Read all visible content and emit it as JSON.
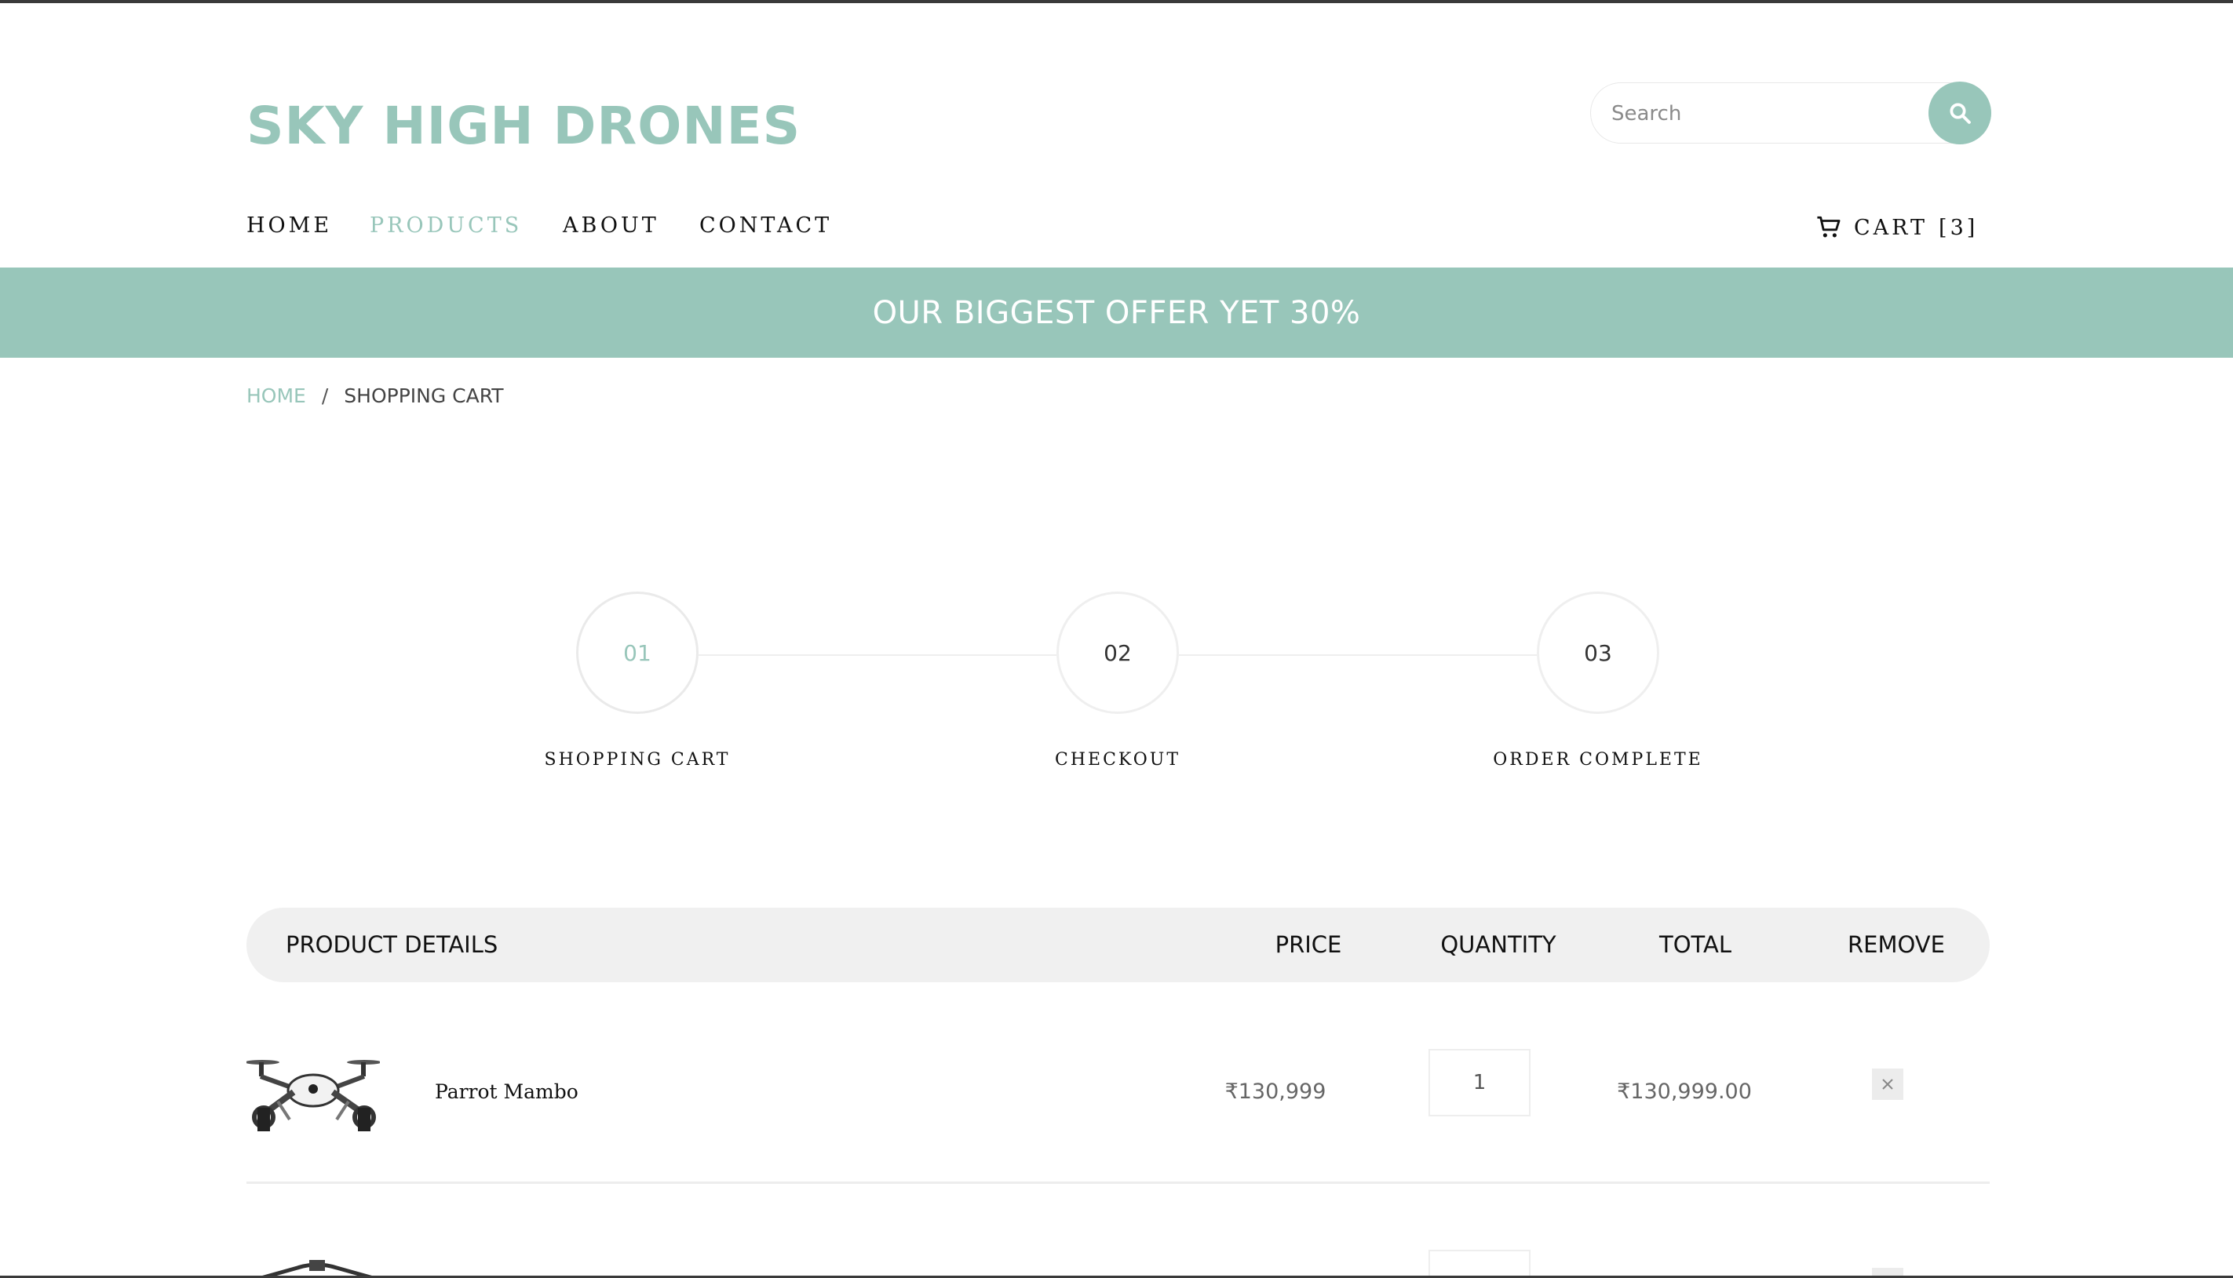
{
  "brand": {
    "name": "SKY HIGH DRONES",
    "accent": "#98c6ba"
  },
  "search": {
    "placeholder": "Search",
    "icon": "search-icon"
  },
  "nav": {
    "items": [
      "HOME",
      "PRODUCTS",
      "ABOUT",
      "CONTACT"
    ],
    "active": "PRODUCTS"
  },
  "cart": {
    "label": "CART",
    "count": "[3]",
    "icon": "cart-icon"
  },
  "banner": {
    "text": "OUR BIGGEST OFFER YET 30%"
  },
  "breadcrumb": {
    "home": "HOME",
    "separator": "/",
    "current": "SHOPPING CART"
  },
  "steps": [
    {
      "number": "01",
      "label": "SHOPPING CART",
      "active": true
    },
    {
      "number": "02",
      "label": "CHECKOUT",
      "active": false
    },
    {
      "number": "03",
      "label": "ORDER COMPLETE",
      "active": false
    }
  ],
  "table": {
    "headers": {
      "product": "PRODUCT DETAILS",
      "price": "PRICE",
      "quantity": "QUANTITY",
      "total": "TOTAL",
      "remove": "REMOVE"
    },
    "rows": [
      {
        "name": "Parrot Mambo",
        "price": "₹130,999",
        "quantity": "1",
        "total": "₹130,999.00",
        "image": "drone-image"
      }
    ]
  }
}
